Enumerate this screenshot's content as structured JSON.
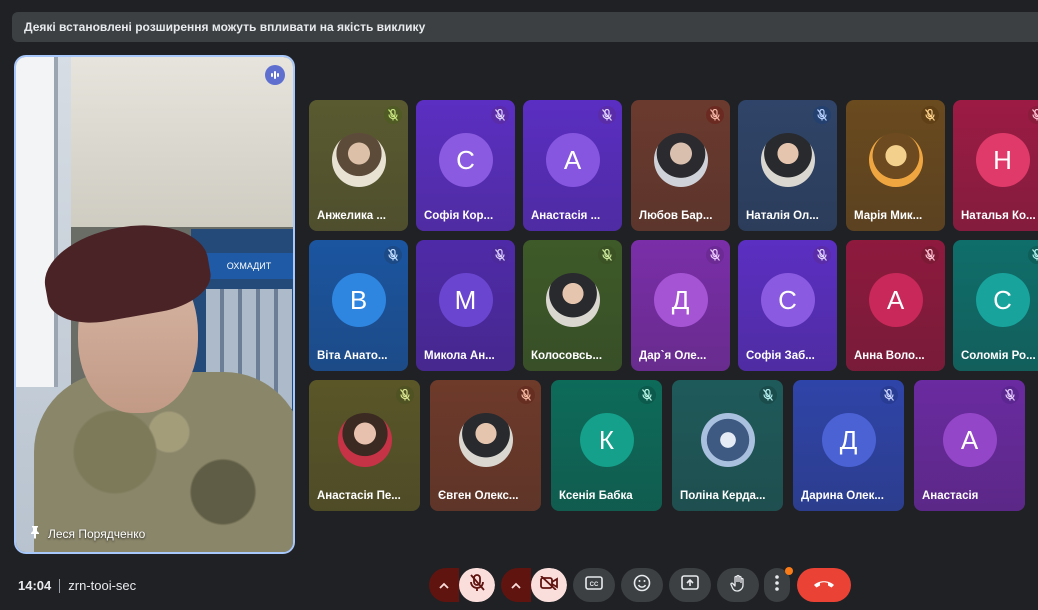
{
  "banner": {
    "text": "Деякі встановлені розширення можуть впливати на якість виклику"
  },
  "main_speaker": {
    "name": "Леся Порядченко",
    "poster_text": "ОХМАДИТ"
  },
  "tiles": [
    {
      "name": "Анжелика ...",
      "type": "photo",
      "photo": "olive",
      "bg": "#5a5a30",
      "mic_bg": "#4f5a24",
      "mic_color": "#c6e37e"
    },
    {
      "name": "Софія Кор...",
      "type": "letter",
      "letter": "С",
      "bg": "#5b2fc2",
      "av_bg": "#8a5ae0",
      "mic_bg": "#5a2ca8",
      "mic_color": "#e2d5ff"
    },
    {
      "name": "Анастасія ...",
      "type": "letter",
      "letter": "А",
      "bg": "#5a2ec2",
      "av_bg": "#8656e0",
      "mic_bg": "#5a2ca8",
      "mic_color": "#e2d5ff"
    },
    {
      "name": "Любов Бар...",
      "type": "photo",
      "photo": "dark",
      "bg": "#6b3a2e",
      "mic_bg": "#6a2a22",
      "mic_color": "#f6b4a4"
    },
    {
      "name": "Наталія Ол...",
      "type": "photo",
      "photo": "person",
      "bg": "#2f4468",
      "mic_bg": "#23406e",
      "mic_color": "#b8d0ff"
    },
    {
      "name": "Марія Мик...",
      "type": "photo",
      "photo": "warm",
      "bg": "#6a4a1f",
      "mic_bg": "#5f3f16",
      "mic_color": "#ffd28a"
    },
    {
      "name": "Наталья Ко...",
      "type": "letter",
      "letter": "Н",
      "bg": "#9c1b44",
      "av_bg": "#e03a6a",
      "mic_bg": "#8a1c3c",
      "mic_color": "#ffc2d2"
    },
    {
      "name": "Віта Анато...",
      "type": "letter",
      "letter": "В",
      "bg": "#1b55a0",
      "av_bg": "#2f86e0",
      "mic_bg": "#1c4a86",
      "mic_color": "#c2ddff"
    },
    {
      "name": "Микола Ан...",
      "type": "letter",
      "letter": "М",
      "bg": "#4f2aa8",
      "av_bg": "#6a45d0",
      "mic_bg": "#4c2a9c",
      "mic_color": "#dccfff"
    },
    {
      "name": "Колосовсь...",
      "type": "photo",
      "photo": "person",
      "bg": "#3e5a28",
      "mic_bg": "#3b5224",
      "mic_color": "#cbe79a"
    },
    {
      "name": "Дар`я Оле...",
      "type": "letter",
      "letter": "Д",
      "bg": "#7a2ea8",
      "av_bg": "#a554d4",
      "mic_bg": "#6c2a94",
      "mic_color": "#ecccff"
    },
    {
      "name": "Софія Заб...",
      "type": "letter",
      "letter": "С",
      "bg": "#5b2fc2",
      "av_bg": "#8a5ae0",
      "mic_bg": "#5a2ca8",
      "mic_color": "#e2d5ff"
    },
    {
      "name": "Анна Воло...",
      "type": "letter",
      "letter": "А",
      "bg": "#8e1a3e",
      "av_bg": "#c8285a",
      "mic_bg": "#7c1a36",
      "mic_color": "#ffc4d4"
    },
    {
      "name": "Соломія Ро...",
      "type": "letter",
      "letter": "С",
      "bg": "#0f6e6a",
      "av_bg": "#18a39c",
      "mic_bg": "#0e5e5a",
      "mic_color": "#b6f2ec"
    },
    {
      "name": "Анастасія Пе...",
      "type": "photo",
      "photo": "red",
      "bg": "#5a5628",
      "mic_bg": "#4f5222",
      "mic_color": "#d8e58e"
    },
    {
      "name": "Євген Олекс...",
      "type": "photo",
      "photo": "person",
      "bg": "#6e3a2a",
      "mic_bg": "#652e20",
      "mic_color": "#f7b8a0"
    },
    {
      "name": "Ксенія Бабка",
      "type": "letter",
      "letter": "К",
      "bg": "#0d6b5a",
      "av_bg": "#14a08a",
      "mic_bg": "#0b5a4c",
      "mic_color": "#b6f2e2"
    },
    {
      "name": "Поліна Керда...",
      "type": "photo",
      "photo": "sky",
      "bg": "#1f5a5a",
      "mic_bg": "#1a4c4c",
      "mic_color": "#b2ecec"
    },
    {
      "name": "Дарина Олек...",
      "type": "letter",
      "letter": "Д",
      "bg": "#2f44a8",
      "av_bg": "#4a62d4",
      "mic_bg": "#283c94",
      "mic_color": "#cad4ff"
    },
    {
      "name": "Анастасія",
      "type": "letter",
      "letter": "А",
      "bg": "#6a2aa0",
      "av_bg": "#9446c8",
      "mic_bg": "#5c2690",
      "mic_color": "#e6ccff"
    }
  ],
  "footer": {
    "time": "14:04",
    "meeting_code": "zrn-tooi-sec"
  },
  "colors": {
    "background": "#202124",
    "end_call": "#ea4335",
    "muted_button": "#f9dedc",
    "muted_dark": "#601410",
    "control": "#3c4043",
    "active_outline": "#a8c7fa"
  },
  "controls": [
    {
      "name": "microphone-off",
      "icon": "mic-off-icon"
    },
    {
      "name": "camera-off",
      "icon": "camera-off-icon"
    },
    {
      "name": "captions",
      "icon": "closed-captions-icon"
    },
    {
      "name": "reactions",
      "icon": "emoji-icon"
    },
    {
      "name": "present",
      "icon": "present-screen-icon"
    },
    {
      "name": "raise-hand",
      "icon": "hand-icon"
    },
    {
      "name": "more-options",
      "icon": "more-vert-icon"
    },
    {
      "name": "end-call",
      "icon": "phone-hangup-icon"
    }
  ]
}
